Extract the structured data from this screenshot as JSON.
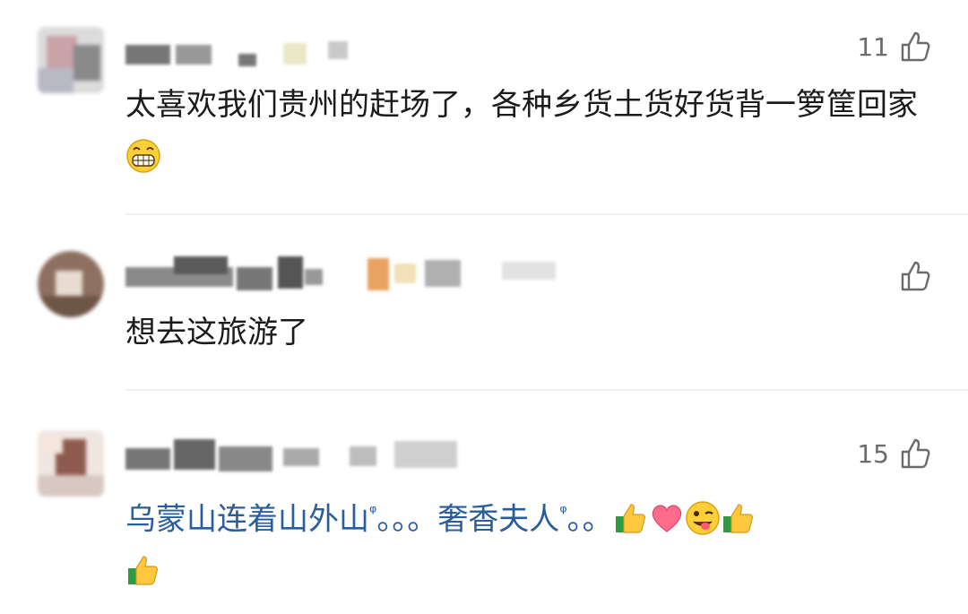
{
  "comments": [
    {
      "likes": "11",
      "text": "太喜欢我们贵州的赶场了，各种乡货土货好货背一箩筐回家",
      "text_color": "#1b1b1b",
      "emojis": [
        "grin-emoji"
      ]
    },
    {
      "likes": "",
      "text": "想去这旅游了",
      "text_color": "#1b1b1b",
      "emojis": []
    },
    {
      "likes": "15",
      "text_parts": [
        "乌蒙山连着山外山",
        "。。。",
        "奢香夫人",
        "。。"
      ],
      "search_mark": "ᵠ",
      "text_color": "#2a5d9c",
      "emojis": [
        "thumbs-up-emoji",
        "heart-emoji",
        "wink-tongue-emoji",
        "thumbs-up-emoji",
        "thumbs-up-emoji"
      ]
    }
  ],
  "colors": {
    "like_gray": "#6b6b6b",
    "divider": "#f0f0f0",
    "link_blue": "#2a5d9c"
  }
}
